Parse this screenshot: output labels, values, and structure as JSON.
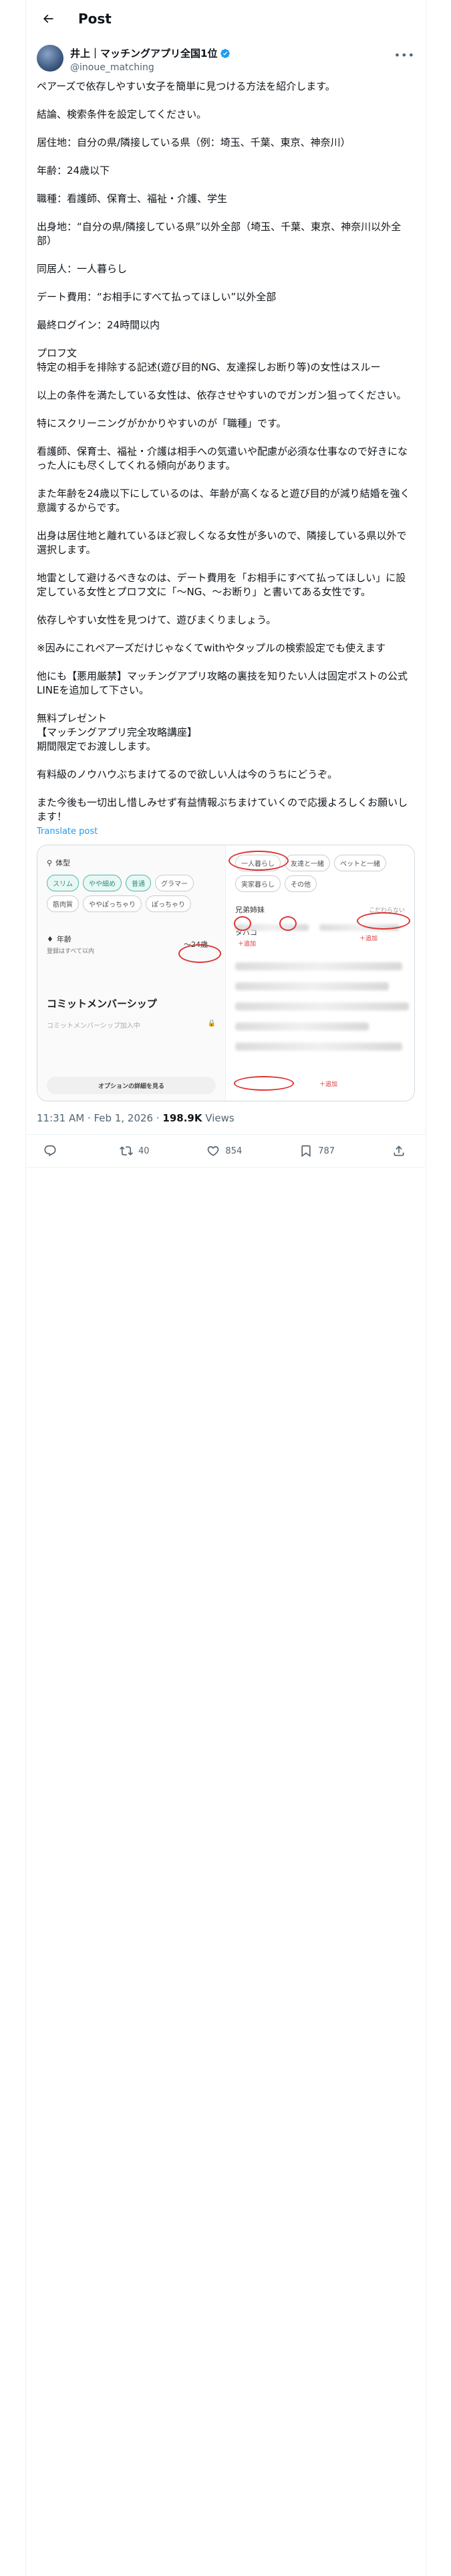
{
  "header": {
    "title": "Post"
  },
  "author": {
    "name": "井上｜マッチングアプリ全国1位",
    "handle": "@inoue_matching"
  },
  "body": {
    "paragraphs": [
      "ペアーズで依存しやすい女子を簡単に見つける方法を紹介します。",
      "結論、検索条件を設定してください。",
      "居住地：自分の県/隣接している県（例：埼玉、千葉、東京、神奈川）",
      "年齢：24歳以下",
      "職種：看護師、保育士、福祉・介護、学生",
      "出身地：“自分の県/隣接している県”以外全部（埼玉、千葉、東京、神奈川以外全部）",
      "同居人：一人暮らし",
      "デート費用：“お相手にすべて払ってほしい”以外全部",
      "最終ログイン：24時間以内",
      "プロフ文\n特定の相手を排除する記述(遊び目的NG、友達探しお断り等)の女性はスルー",
      "以上の条件を満たしている女性は、依存させやすいのでガンガン狙ってください。",
      "特にスクリーニングがかかりやすいのが「職種」です。",
      "看護師、保育士、福祉・介護は相手への気遣いや配慮が必須な仕事なので好きになった人にも尽くしてくれる傾向があります。",
      "また年齢を24歳以下にしているのは、年齢が高くなると遊び目的が減り結婚を強く意識するからです。",
      "出身は居住地と離れているほど寂しくなる女性が多いので、隣接している県以外で選択します。",
      "地雷として避けるべきなのは、デート費用を「お相手にすべて払ってほしい」に設定している女性とプロフ文に「〜NG、〜お断り」と書いてある女性です。",
      "依存しやすい女性を見つけて、遊びまくりましょう。",
      "※因みにこれペアーズだけじゃなくてwithやタップルの検索設定でも使えます",
      "他にも【悪用厳禁】マッチングアプリ攻略の裏技を知りたい人は固定ポストの公式LINEを追加して下さい。",
      "無料プレゼント\n【マッチングアプリ完全攻略講座】\n期間限定でお渡しします。",
      "有料級のノウハウぶちまけてるので欲しい人は今のうちにどうぞ。",
      "また今後も一切出し惜しみせず有益情報ぶちまけていくので応援よろしくお願いします！"
    ],
    "translate_link": "Translate post"
  },
  "media": {
    "left": {
      "body_type_label": "体型",
      "body_chips": [
        "スリム",
        "やや細め",
        "普通",
        "グラマー",
        "筋肉質",
        "ややぽっちゃり",
        "ぽっちゃり"
      ],
      "age_label": "年齢",
      "age_sub": "登録はすべて以内",
      "age_value": "〜24歳",
      "commit_heading": "コミットメンバーシップ",
      "commit_sub": "コミットメンバーシップ加入中",
      "options_button": "オプションの詳細を見る"
    },
    "right": {
      "living_chips": [
        "一人暮らし",
        "友達と一緒",
        "ペットと一緒",
        "実家暮らし",
        "その他"
      ],
      "siblings_label": "兄弟姉妹",
      "siblings_value": "こだわらない",
      "tobacco_label": "タバコ",
      "add_note": "＋追加"
    }
  },
  "meta": {
    "time": "11:31 AM · Feb 1, 2026",
    "views_count": "198.9K",
    "views_label": "Views"
  },
  "actions": {
    "replies": "",
    "reposts": "40",
    "likes": "854",
    "bookmarks": "787"
  },
  "colors": {
    "accent": "#1d9bf0",
    "verified": "#1d9bf0",
    "circle": "#d33333"
  }
}
